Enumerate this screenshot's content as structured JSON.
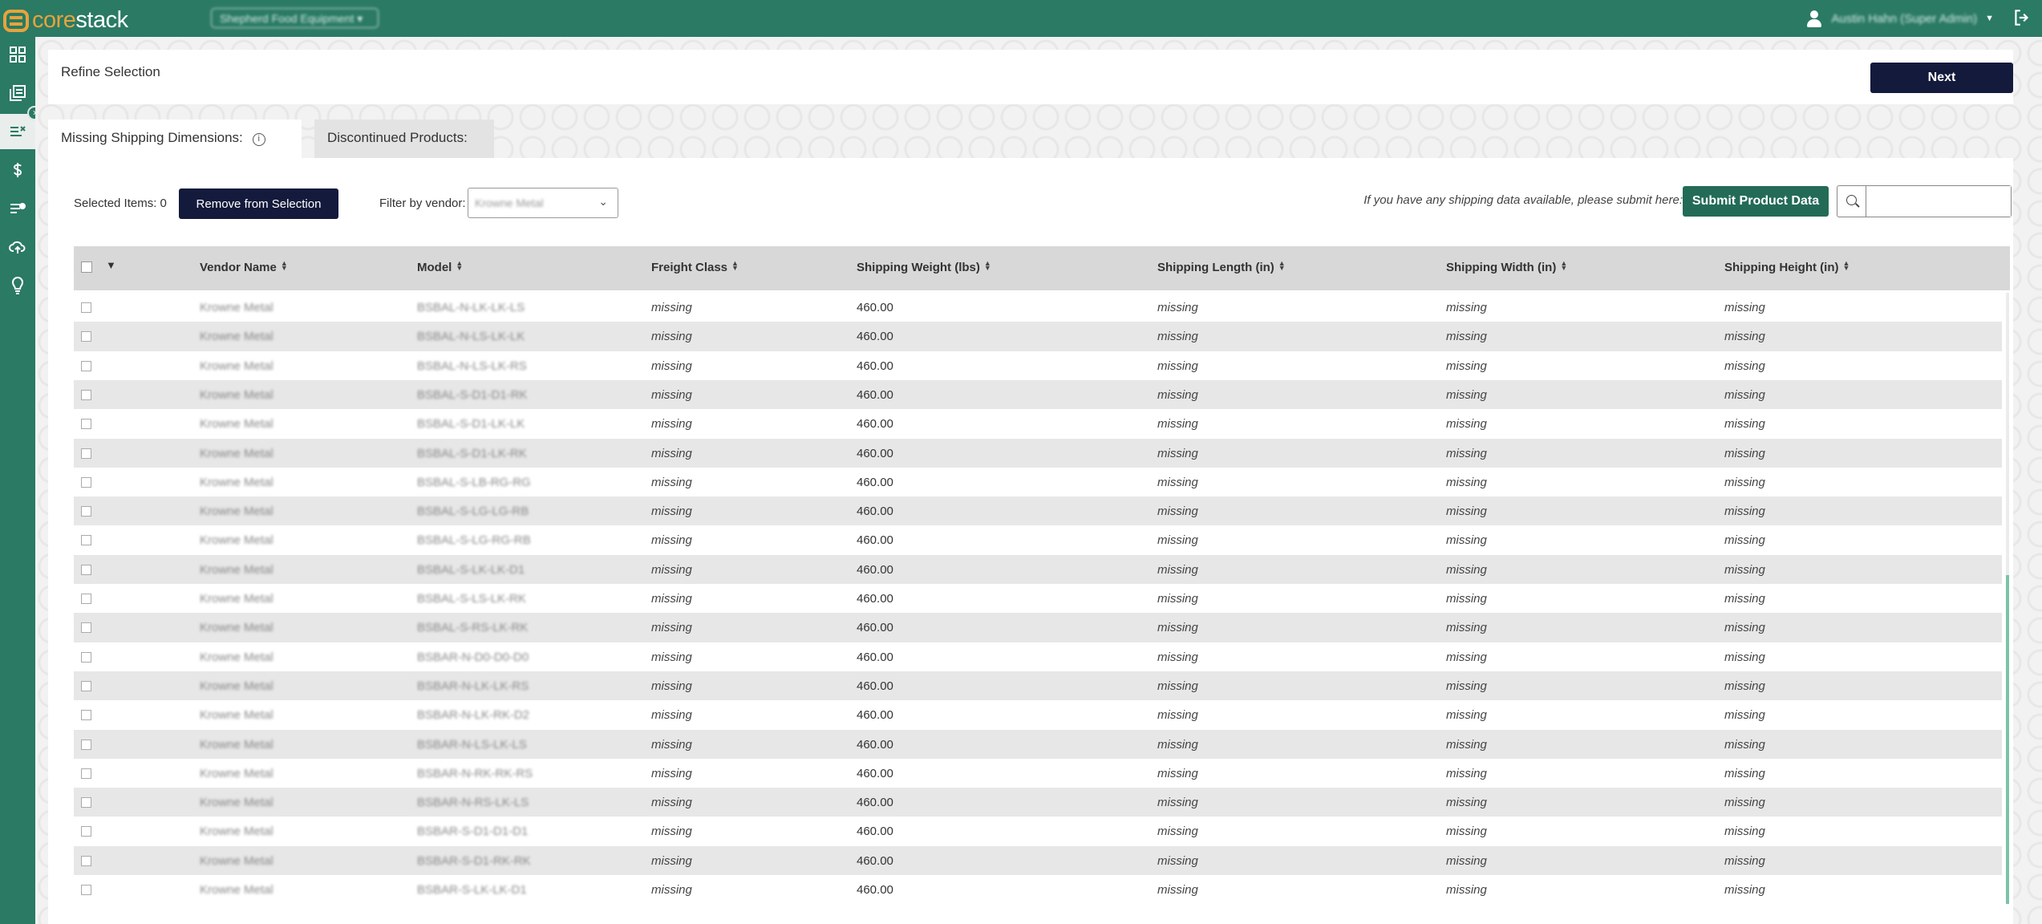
{
  "app": {
    "logo_core": "core",
    "logo_stack": "stack",
    "company_selector": "Shepherd Food Equipment",
    "user_name": "Austin Hahn (Super Admin)"
  },
  "sidebar": {
    "items": [
      {
        "icon": "dashboard-grid-icon"
      },
      {
        "icon": "catalog-icon"
      },
      {
        "icon": "filter-list-icon",
        "active": true
      },
      {
        "icon": "dollar-icon"
      },
      {
        "icon": "list-check-icon"
      },
      {
        "icon": "cloud-upload-icon"
      },
      {
        "icon": "lightbulb-icon"
      }
    ]
  },
  "header": {
    "title": "Refine Selection",
    "next_label": "Next"
  },
  "tabs": [
    {
      "label": "Missing Shipping Dimensions:",
      "active": true
    },
    {
      "label": "Discontinued Products:",
      "active": false
    }
  ],
  "toolbar": {
    "selected_items": "Selected Items: 0",
    "remove_label": "Remove from Selection",
    "filter_label": "Filter by vendor:",
    "vendor_value": "Krowne Metal",
    "submit_note": "If you have any shipping data available, please submit here:",
    "submit_label": "Submit Product Data",
    "search_placeholder": ""
  },
  "table": {
    "columns": [
      "Vendor Name",
      "Model",
      "Freight Class",
      "Shipping Weight (lbs)",
      "Shipping Length (in)",
      "Shipping Width (in)",
      "Shipping Height (in)"
    ],
    "rows": [
      {
        "vendor": "Krowne Metal",
        "model": "BSBAL-N-LK-LK-LS",
        "freight": "missing",
        "weight": "460.00",
        "length": "missing",
        "width": "missing",
        "height": "missing"
      },
      {
        "vendor": "Krowne Metal",
        "model": "BSBAL-N-LS-LK-LK",
        "freight": "missing",
        "weight": "460.00",
        "length": "missing",
        "width": "missing",
        "height": "missing"
      },
      {
        "vendor": "Krowne Metal",
        "model": "BSBAL-N-LS-LK-RS",
        "freight": "missing",
        "weight": "460.00",
        "length": "missing",
        "width": "missing",
        "height": "missing"
      },
      {
        "vendor": "Krowne Metal",
        "model": "BSBAL-S-D1-D1-RK",
        "freight": "missing",
        "weight": "460.00",
        "length": "missing",
        "width": "missing",
        "height": "missing"
      },
      {
        "vendor": "Krowne Metal",
        "model": "BSBAL-S-D1-LK-LK",
        "freight": "missing",
        "weight": "460.00",
        "length": "missing",
        "width": "missing",
        "height": "missing"
      },
      {
        "vendor": "Krowne Metal",
        "model": "BSBAL-S-D1-LK-RK",
        "freight": "missing",
        "weight": "460.00",
        "length": "missing",
        "width": "missing",
        "height": "missing"
      },
      {
        "vendor": "Krowne Metal",
        "model": "BSBAL-S-LB-RG-RG",
        "freight": "missing",
        "weight": "460.00",
        "length": "missing",
        "width": "missing",
        "height": "missing"
      },
      {
        "vendor": "Krowne Metal",
        "model": "BSBAL-S-LG-LG-RB",
        "freight": "missing",
        "weight": "460.00",
        "length": "missing",
        "width": "missing",
        "height": "missing"
      },
      {
        "vendor": "Krowne Metal",
        "model": "BSBAL-S-LG-RG-RB",
        "freight": "missing",
        "weight": "460.00",
        "length": "missing",
        "width": "missing",
        "height": "missing"
      },
      {
        "vendor": "Krowne Metal",
        "model": "BSBAL-S-LK-LK-D1",
        "freight": "missing",
        "weight": "460.00",
        "length": "missing",
        "width": "missing",
        "height": "missing"
      },
      {
        "vendor": "Krowne Metal",
        "model": "BSBAL-S-LS-LK-RK",
        "freight": "missing",
        "weight": "460.00",
        "length": "missing",
        "width": "missing",
        "height": "missing"
      },
      {
        "vendor": "Krowne Metal",
        "model": "BSBAL-S-RS-LK-RK",
        "freight": "missing",
        "weight": "460.00",
        "length": "missing",
        "width": "missing",
        "height": "missing"
      },
      {
        "vendor": "Krowne Metal",
        "model": "BSBAR-N-D0-D0-D0",
        "freight": "missing",
        "weight": "460.00",
        "length": "missing",
        "width": "missing",
        "height": "missing"
      },
      {
        "vendor": "Krowne Metal",
        "model": "BSBAR-N-LK-LK-RS",
        "freight": "missing",
        "weight": "460.00",
        "length": "missing",
        "width": "missing",
        "height": "missing"
      },
      {
        "vendor": "Krowne Metal",
        "model": "BSBAR-N-LK-RK-D2",
        "freight": "missing",
        "weight": "460.00",
        "length": "missing",
        "width": "missing",
        "height": "missing"
      },
      {
        "vendor": "Krowne Metal",
        "model": "BSBAR-N-LS-LK-LS",
        "freight": "missing",
        "weight": "460.00",
        "length": "missing",
        "width": "missing",
        "height": "missing"
      },
      {
        "vendor": "Krowne Metal",
        "model": "BSBAR-N-RK-RK-RS",
        "freight": "missing",
        "weight": "460.00",
        "length": "missing",
        "width": "missing",
        "height": "missing"
      },
      {
        "vendor": "Krowne Metal",
        "model": "BSBAR-N-RS-LK-LS",
        "freight": "missing",
        "weight": "460.00",
        "length": "missing",
        "width": "missing",
        "height": "missing"
      },
      {
        "vendor": "Krowne Metal",
        "model": "BSBAR-S-D1-D1-D1",
        "freight": "missing",
        "weight": "460.00",
        "length": "missing",
        "width": "missing",
        "height": "missing"
      },
      {
        "vendor": "Krowne Metal",
        "model": "BSBAR-S-D1-RK-RK",
        "freight": "missing",
        "weight": "460.00",
        "length": "missing",
        "width": "missing",
        "height": "missing"
      },
      {
        "vendor": "Krowne Metal",
        "model": "BSBAR-S-LK-LK-D1",
        "freight": "missing",
        "weight": "460.00",
        "length": "missing",
        "width": "missing",
        "height": "missing"
      }
    ]
  },
  "colors": {
    "brand_green": "#2a7a64",
    "logo_orange": "#e8a33a",
    "navy_button": "#141a3c",
    "submit_green": "#236b57"
  }
}
